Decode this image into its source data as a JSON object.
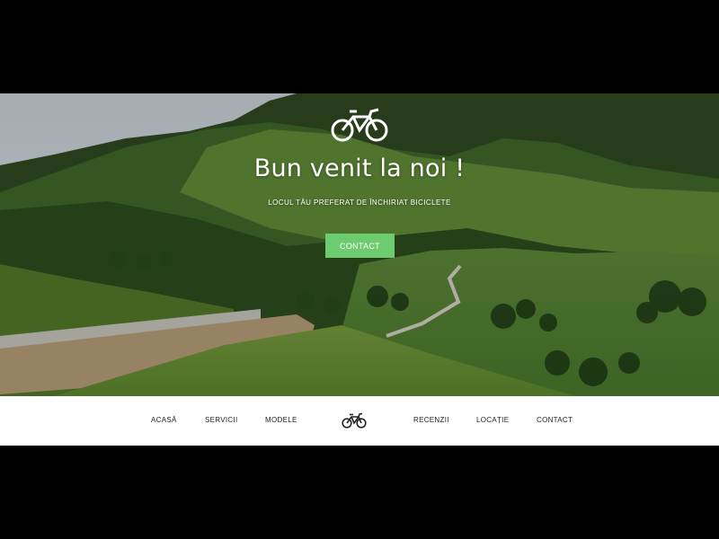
{
  "hero": {
    "title": "Bun venit la noi !",
    "subtitle": "LOCUL TĂU PREFERAT DE ÎNCHIRIAT BICICLETE",
    "cta_label": "CONTACT",
    "logo_icon": "bicycle-icon",
    "accent_color": "#6ccc6f"
  },
  "nav": {
    "items": [
      {
        "label": "ACASĂ"
      },
      {
        "label": "SERVICII"
      },
      {
        "label": "MODELE"
      },
      {
        "label": "RECENZII"
      },
      {
        "label": "LOCAȚIE"
      },
      {
        "label": "CONTACT"
      }
    ],
    "logo_icon": "bicycle-icon"
  }
}
